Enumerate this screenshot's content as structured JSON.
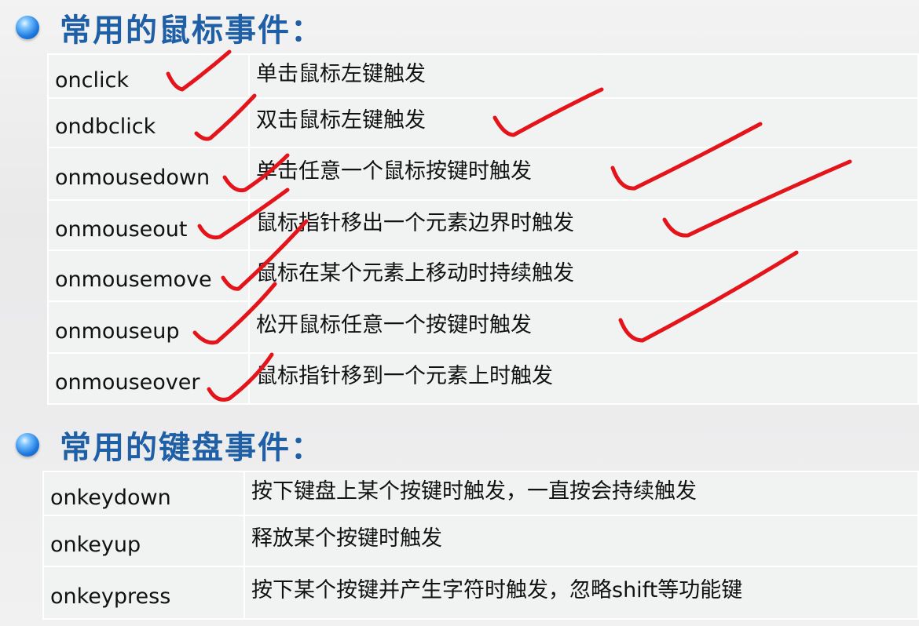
{
  "sections": {
    "mouse": {
      "title": "常用的鼠标事件：",
      "rows": [
        {
          "event": "onclick",
          "description": "单击鼠标左键触发"
        },
        {
          "event": "ondbclick",
          "description": "双击鼠标左键触发"
        },
        {
          "event": "onmousedown",
          "description": "单击任意一个鼠标按键时触发"
        },
        {
          "event": "onmouseout",
          "description": "鼠标指针移出一个元素边界时触发"
        },
        {
          "event": "onmousemove",
          "description": "鼠标在某个元素上移动时持续触发"
        },
        {
          "event": "onmouseup",
          "description": "松开鼠标任意一个按键时触发"
        },
        {
          "event": "onmouseover",
          "description": "鼠标指针移到一个元素上时触发"
        }
      ]
    },
    "keyboard": {
      "title": "常用的键盘事件：",
      "rows": [
        {
          "event": "onkeydown",
          "description": "按下键盘上某个按键时触发，一直按会持续触发"
        },
        {
          "event": "onkeyup",
          "description": "释放某个按键时触发"
        },
        {
          "event": "onkeypress",
          "description": "按下某个按键并产生字符时触发，忽略shift等功能键"
        }
      ]
    }
  },
  "colors": {
    "title": "#1f5fa6",
    "annotation": "#e4141b",
    "cell_background": "#f1f2f2"
  }
}
